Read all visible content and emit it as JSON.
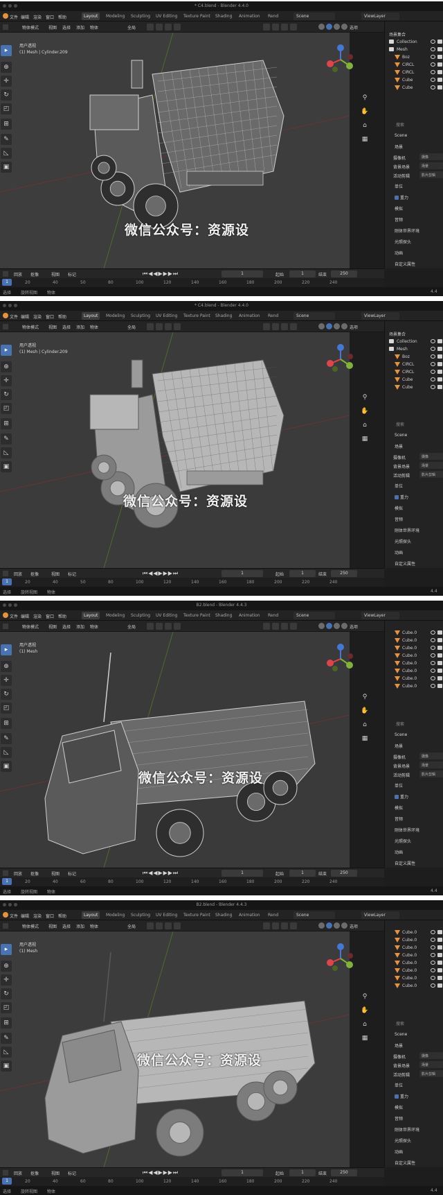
{
  "panels": [
    {
      "window_title": "* C4.blend - Blender 4.4.0",
      "viewport_info": [
        "用户透视",
        "(1) Mesh | Cylinder.209"
      ],
      "viewport_bg": "#3d3d3d",
      "style": "wire",
      "outliner_header": "场景集合",
      "outliner": [
        {
          "label": "Collection",
          "type": "collection",
          "depth": 0
        },
        {
          "label": "Mesh",
          "type": "collection",
          "depth": 0
        },
        {
          "label": "Boz",
          "type": "mesh",
          "depth": 1
        },
        {
          "label": "CIRCL",
          "type": "mesh",
          "depth": 1
        },
        {
          "label": "CIRCL",
          "type": "mesh",
          "depth": 1
        },
        {
          "label": "Cube",
          "type": "mesh",
          "depth": 1
        },
        {
          "label": "Cube",
          "type": "mesh",
          "depth": 1
        }
      ],
      "scene_header": "Scene",
      "props_section": "场景",
      "props_rows": [
        {
          "label": "摄像机",
          "value": "摄像"
        },
        {
          "label": "背景场景",
          "value": "场景"
        },
        {
          "label": "活动剪辑",
          "value": "影片剪辑"
        }
      ],
      "props_sections": [
        "单位",
        "重力",
        "模拟",
        "音频",
        "刚体世界环境",
        "光照探头",
        "动画",
        "自定义属性"
      ],
      "gravity_checked_index": 1,
      "ruler_ticks": [
        "1",
        "20",
        "40",
        "50",
        "80",
        "100",
        "120",
        "140",
        "160",
        "180",
        "200",
        "220",
        "240"
      ]
    },
    {
      "window_title": "* C4.blend - Blender 4.4.0",
      "viewport_info": [
        "用户透视",
        "(1) Mesh | Cylinder.209"
      ],
      "viewport_bg": "#3b3b3b",
      "style": "solid",
      "outliner_header": "场景集合",
      "outliner": [
        {
          "label": "Collection",
          "type": "collection",
          "depth": 0
        },
        {
          "label": "Mesh",
          "type": "collection",
          "depth": 0
        },
        {
          "label": "Boz",
          "type": "mesh",
          "depth": 1
        },
        {
          "label": "CIRCL",
          "type": "mesh",
          "depth": 1
        },
        {
          "label": "CIRCL",
          "type": "mesh",
          "depth": 1
        },
        {
          "label": "Cube",
          "type": "mesh",
          "depth": 1
        },
        {
          "label": "Cube",
          "type": "mesh",
          "depth": 1
        }
      ],
      "scene_header": "Scene",
      "props_section": "场景",
      "props_rows": [
        {
          "label": "摄像机",
          "value": "摄像"
        },
        {
          "label": "背景场景",
          "value": "场景"
        },
        {
          "label": "活动剪辑",
          "value": "影片剪辑"
        }
      ],
      "props_sections": [
        "单位",
        "重力",
        "模拟",
        "音频",
        "刚体世界环境",
        "光照探头",
        "动画",
        "自定义属性"
      ],
      "gravity_checked_index": 1,
      "ruler_ticks": [
        "1",
        "20",
        "40",
        "50",
        "80",
        "100",
        "120",
        "140",
        "160",
        "180",
        "200",
        "220",
        "240"
      ]
    },
    {
      "window_title": "B2.blend - Blender 4.4.3",
      "viewport_info": [
        "用户透视",
        "(1) Mesh"
      ],
      "viewport_bg": "#3a3a3a",
      "style": "wire2",
      "outliner_header": "",
      "outliner": [
        {
          "label": "Cube.0",
          "type": "mesh",
          "depth": 1
        },
        {
          "label": "Cube.0",
          "type": "mesh",
          "depth": 1
        },
        {
          "label": "Cube.0",
          "type": "mesh",
          "depth": 1
        },
        {
          "label": "Cube.0",
          "type": "mesh",
          "depth": 1
        },
        {
          "label": "Cube.0",
          "type": "mesh",
          "depth": 1
        },
        {
          "label": "Cube.0",
          "type": "mesh",
          "depth": 1
        },
        {
          "label": "Cube.0",
          "type": "mesh",
          "depth": 1
        },
        {
          "label": "Cube.0",
          "type": "mesh",
          "depth": 1
        }
      ],
      "scene_header": "Scene",
      "props_section": "场景",
      "props_rows": [
        {
          "label": "摄像机",
          "value": "摄像"
        },
        {
          "label": "背景场景",
          "value": "场景"
        },
        {
          "label": "活动剪辑",
          "value": "影片剪辑"
        }
      ],
      "props_sections": [
        "单位",
        "重力",
        "模拟",
        "音频",
        "刚体世界环境",
        "光照探头",
        "动画",
        "自定义属性"
      ],
      "gravity_checked_index": 1,
      "ruler_ticks": [
        "1",
        "20",
        "40",
        "60",
        "80",
        "100",
        "120",
        "140",
        "160",
        "180",
        "200",
        "220",
        "240"
      ]
    },
    {
      "window_title": "B2.blend - Blender 4.4.3",
      "viewport_info": [
        "用户透视",
        "(1) Mesh"
      ],
      "viewport_bg": "#3c3c3c",
      "style": "solid2",
      "outliner_header": "",
      "outliner": [
        {
          "label": "Cube.0",
          "type": "mesh",
          "depth": 1
        },
        {
          "label": "Cube.0",
          "type": "mesh",
          "depth": 1
        },
        {
          "label": "Cube.0",
          "type": "mesh",
          "depth": 1
        },
        {
          "label": "Cube.0",
          "type": "mesh",
          "depth": 1
        },
        {
          "label": "Cube.0",
          "type": "mesh",
          "depth": 1
        },
        {
          "label": "Cube.0",
          "type": "mesh",
          "depth": 1
        },
        {
          "label": "Cube.0",
          "type": "mesh",
          "depth": 1
        },
        {
          "label": "Cube.0",
          "type": "mesh",
          "depth": 1
        }
      ],
      "scene_header": "Scene",
      "props_section": "场景",
      "props_rows": [
        {
          "label": "摄像机",
          "value": "摄像"
        },
        {
          "label": "背景场景",
          "value": "场景"
        },
        {
          "label": "活动剪辑",
          "value": "影片剪辑"
        }
      ],
      "props_sections": [
        "单位",
        "重力",
        "模拟",
        "音频",
        "刚体世界环境",
        "光照探头",
        "动画",
        "自定义属性"
      ],
      "gravity_checked_index": 1,
      "ruler_ticks": [
        "1",
        "20",
        "40",
        "60",
        "80",
        "100",
        "120",
        "140",
        "160",
        "180",
        "200",
        "220",
        "240"
      ]
    }
  ],
  "menu": [
    "文件",
    "编辑",
    "渲染",
    "窗口",
    "帮助"
  ],
  "workspace_tabs": [
    "Layout",
    "Modeling",
    "Sculpting",
    "UV Editing",
    "Texture Paint",
    "Shading",
    "Animation",
    "Rend"
  ],
  "scene_name": "Scene",
  "view_layer": "ViewLayer",
  "header": {
    "mode": "物体模式",
    "view": "视图",
    "select": "选择",
    "add": "添加",
    "object": "物体",
    "transform": "全局",
    "options": "选项"
  },
  "timeline": {
    "playback": "回放",
    "keying": "抠像",
    "view": "视图",
    "marker": "标记",
    "current_frame": "1",
    "start_label": "起始",
    "start": "1",
    "end_label": "结束",
    "end": "250"
  },
  "status": {
    "select": "选择",
    "rotate": "旋转视图",
    "menu": "物体",
    "version": "4.4"
  },
  "search_placeholder": "搜索",
  "watermark": "微信公众号：资源设",
  "colors": {
    "accent": "#4772b3",
    "axis_x": "#e0434b",
    "axis_y": "#7fb23a",
    "axis_z": "#4278d8",
    "orange_mesh": "#e8923b"
  }
}
